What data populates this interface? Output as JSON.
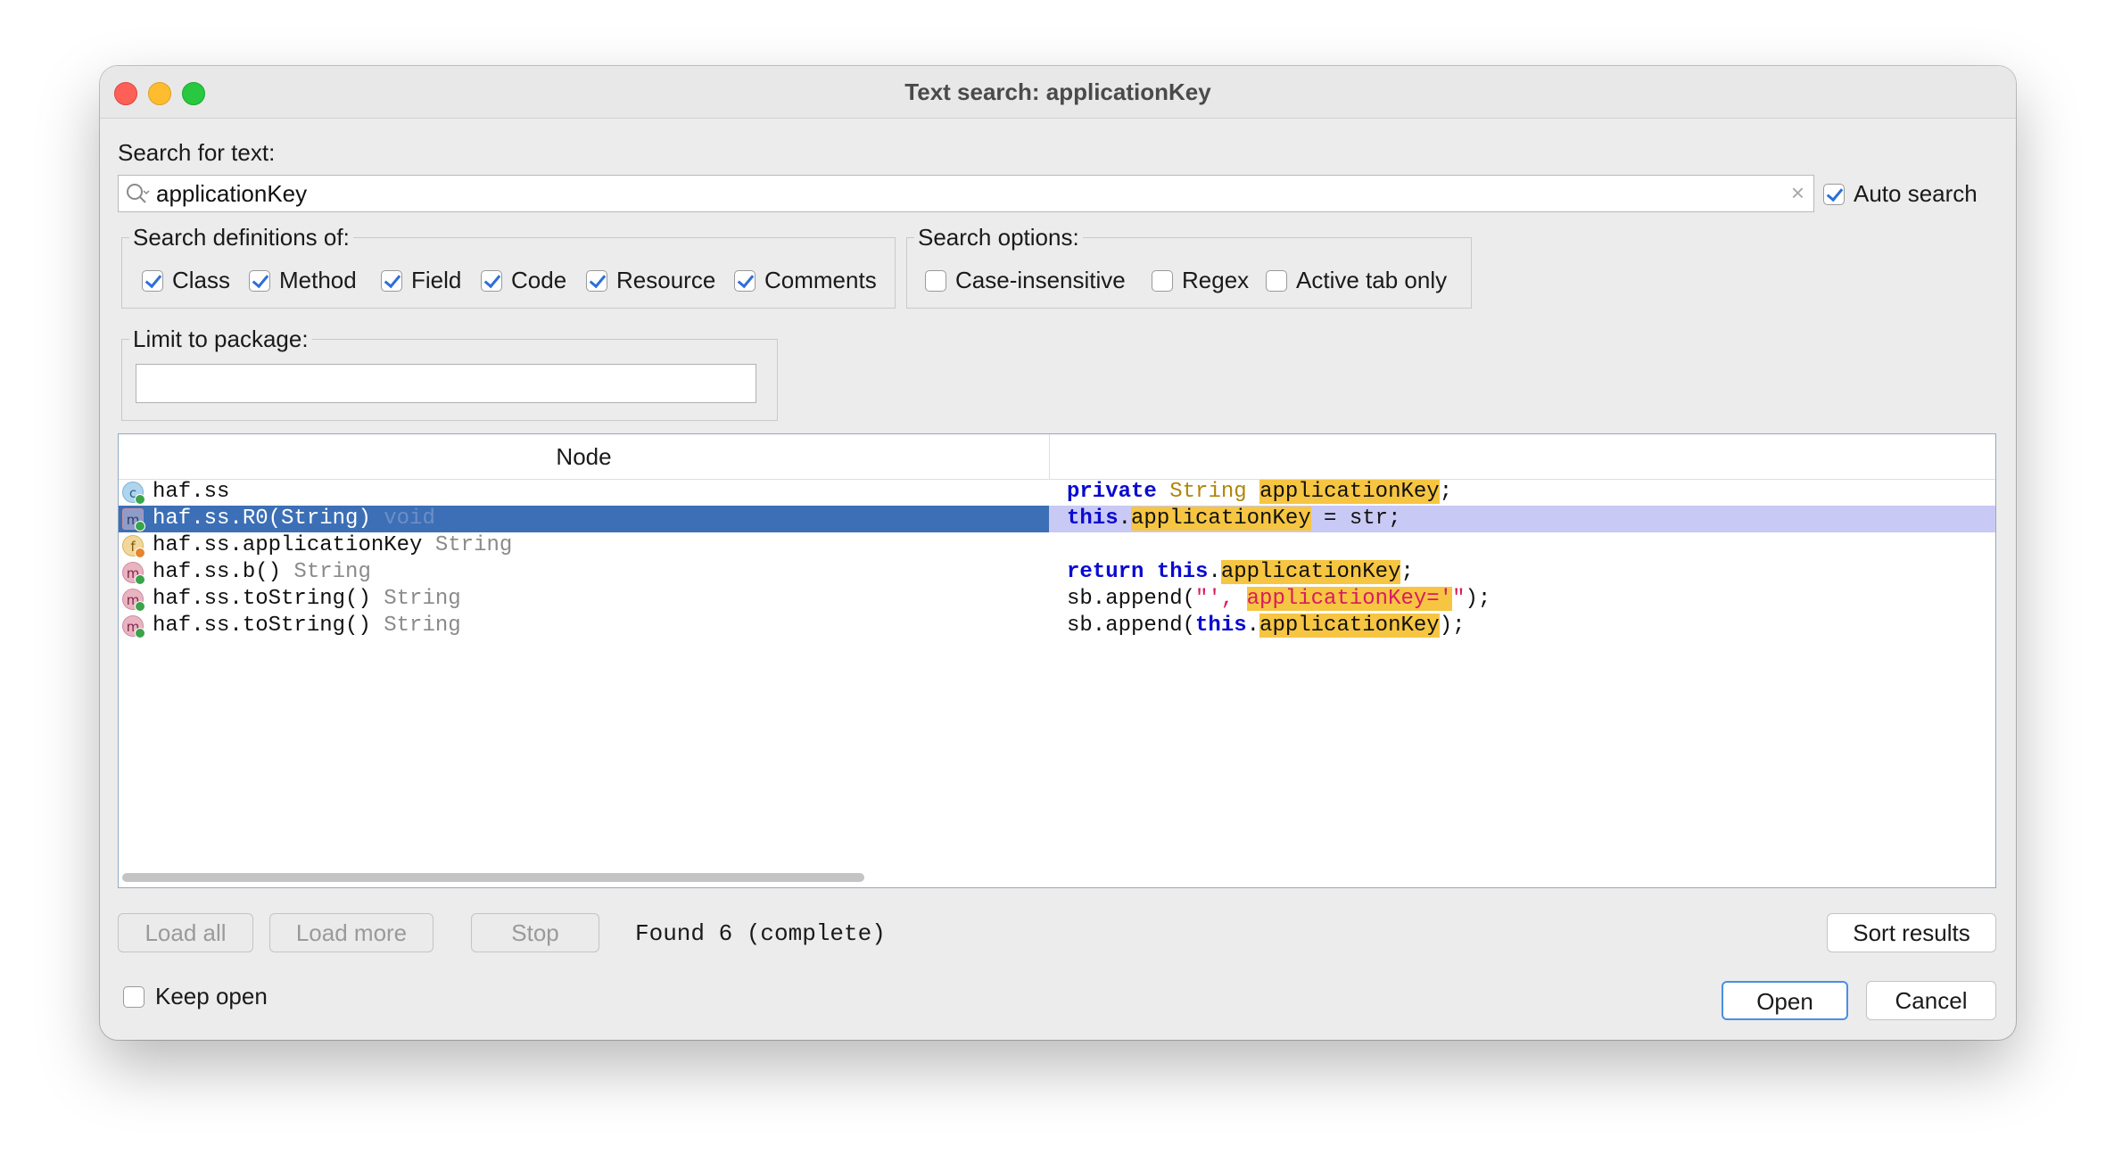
{
  "window": {
    "title": "Text search: applicationKey"
  },
  "search": {
    "label": "Search for text:",
    "value": "applicationKey",
    "clear_glyph": "×",
    "auto_search_label": "Auto search",
    "auto_search_checked": true
  },
  "definitions": {
    "title": "Search definitions of:",
    "items": [
      {
        "label": "Class",
        "checked": true
      },
      {
        "label": "Method",
        "checked": true
      },
      {
        "label": "Field",
        "checked": true
      },
      {
        "label": "Code",
        "checked": true
      },
      {
        "label": "Resource",
        "checked": true
      },
      {
        "label": "Comments",
        "checked": true
      }
    ]
  },
  "options": {
    "title": "Search options:",
    "items": [
      {
        "label": "Case-insensitive",
        "checked": false
      },
      {
        "label": "Regex",
        "checked": false
      },
      {
        "label": "Active tab only",
        "checked": false
      }
    ]
  },
  "package": {
    "title": "Limit to package:",
    "value": ""
  },
  "results": {
    "columns": {
      "node": "Node",
      "code": ""
    },
    "rows": [
      {
        "icon": "c",
        "icon_name": "class-icon",
        "node": "haf.ss",
        "type": "",
        "selected": false,
        "code": [
          {
            "t": "private",
            "c": "kw"
          },
          {
            "t": " "
          },
          {
            "t": "String",
            "c": "ty"
          },
          {
            "t": " "
          },
          {
            "t": "applicationKey",
            "c": "hl"
          },
          {
            "t": ";"
          }
        ]
      },
      {
        "icon": "m",
        "icon_name": "method-icon",
        "node": "haf.ss.R0(String)",
        "type": "void",
        "selected": true,
        "code": [
          {
            "t": "this",
            "c": "kw"
          },
          {
            "t": "."
          },
          {
            "t": "applicationKey",
            "c": "hl"
          },
          {
            "t": " = str;"
          }
        ]
      },
      {
        "icon": "f",
        "icon_name": "field-icon",
        "node": "haf.ss.applicationKey",
        "type": "String",
        "selected": false,
        "code": []
      },
      {
        "icon": "m",
        "icon_name": "method-icon",
        "node": "haf.ss.b()",
        "type": "String",
        "selected": false,
        "code": [
          {
            "t": "return",
            "c": "kw"
          },
          {
            "t": " "
          },
          {
            "t": "this",
            "c": "kw"
          },
          {
            "t": "."
          },
          {
            "t": "applicationKey",
            "c": "hl"
          },
          {
            "t": ";"
          }
        ]
      },
      {
        "icon": "m",
        "icon_name": "method-icon",
        "node": "haf.ss.toString()",
        "type": "String",
        "selected": false,
        "code": [
          {
            "t": "sb.append("
          },
          {
            "t": "\"', ",
            "c": "str"
          },
          {
            "t": "applicationKey='",
            "c": "str hl"
          },
          {
            "t": "\"",
            "c": "str"
          },
          {
            "t": ");"
          }
        ]
      },
      {
        "icon": "m",
        "icon_name": "method-icon",
        "node": "haf.ss.toString()",
        "type": "String",
        "selected": false,
        "code": [
          {
            "t": "sb.append("
          },
          {
            "t": "this",
            "c": "kw"
          },
          {
            "t": "."
          },
          {
            "t": "applicationKey",
            "c": "hl"
          },
          {
            "t": ");"
          }
        ]
      }
    ]
  },
  "footer": {
    "load_all": "Load all",
    "load_more": "Load more",
    "stop": "Stop",
    "status": "Found 6 (complete)",
    "sort_results": "Sort results",
    "keep_open_label": "Keep open",
    "keep_open_checked": false,
    "open": "Open",
    "cancel": "Cancel"
  },
  "colors": {
    "selection_left": "#3c6fb6",
    "selection_right": "#c9c9f5",
    "highlight": "#f6c542",
    "keyword": "#0a0ad0",
    "type": "#b0850a",
    "string": "#d81b60"
  }
}
